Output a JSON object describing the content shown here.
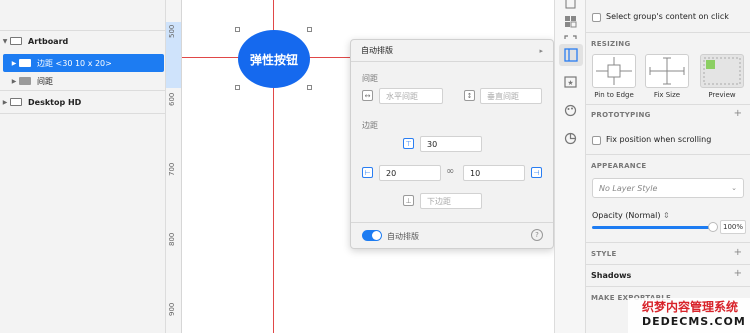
{
  "layers": [
    {
      "name": "Artboard",
      "type": "artboard",
      "expanded": true,
      "selected": false
    },
    {
      "name": "边距 <30 10 x 20>",
      "type": "folder",
      "expanded": false,
      "selected": true
    },
    {
      "name": "间距",
      "type": "folder",
      "expanded": false,
      "selected": false
    },
    {
      "name": "Desktop HD",
      "type": "artboard",
      "expanded": false,
      "selected": false
    }
  ],
  "ruler": {
    "labels": [
      "500",
      "600",
      "700",
      "800",
      "900"
    ]
  },
  "canvas": {
    "button_label": "弹性按钮",
    "button_color": "#1569ee",
    "guide_color": "#e04848"
  },
  "popover": {
    "title": "自动排版",
    "spacing_label": "间距",
    "horizontal_spacing_placeholder": "水平间距",
    "vertical_spacing_placeholder": "垂直间距",
    "padding_label": "边距",
    "padding_top": "30",
    "padding_left": "20",
    "padding_right": "10",
    "padding_bottom_placeholder": "下边距",
    "toggle_label": "自动排版",
    "toggle_on": true,
    "accent": "#1d7cf2"
  },
  "toolbar_icons": [
    "align-icon",
    "grid-icon",
    "layout-icon",
    "resize-icon",
    "symbol-icon",
    "theme-icon",
    "chart-icon"
  ],
  "inspector": {
    "select_group_label": "Select group's content on click",
    "resizing_title": "RESIZING",
    "resizing_options": [
      "Pin to Edge",
      "Fix Size",
      "Preview"
    ],
    "prototyping_title": "PROTOTYPING",
    "fix_position_label": "Fix position when scrolling",
    "appearance_title": "APPEARANCE",
    "layer_style_placeholder": "No Layer Style",
    "opacity_label": "Opacity (Normal)",
    "opacity_value": "100%",
    "opacity_level": 1.0,
    "style_title": "STYLE",
    "shadows_title": "Shadows",
    "make_exportable_title": "MAKE EXPORTABLE"
  },
  "watermark": {
    "line1": "织梦内容管理系统",
    "line2": "DEDECMS.COM"
  }
}
